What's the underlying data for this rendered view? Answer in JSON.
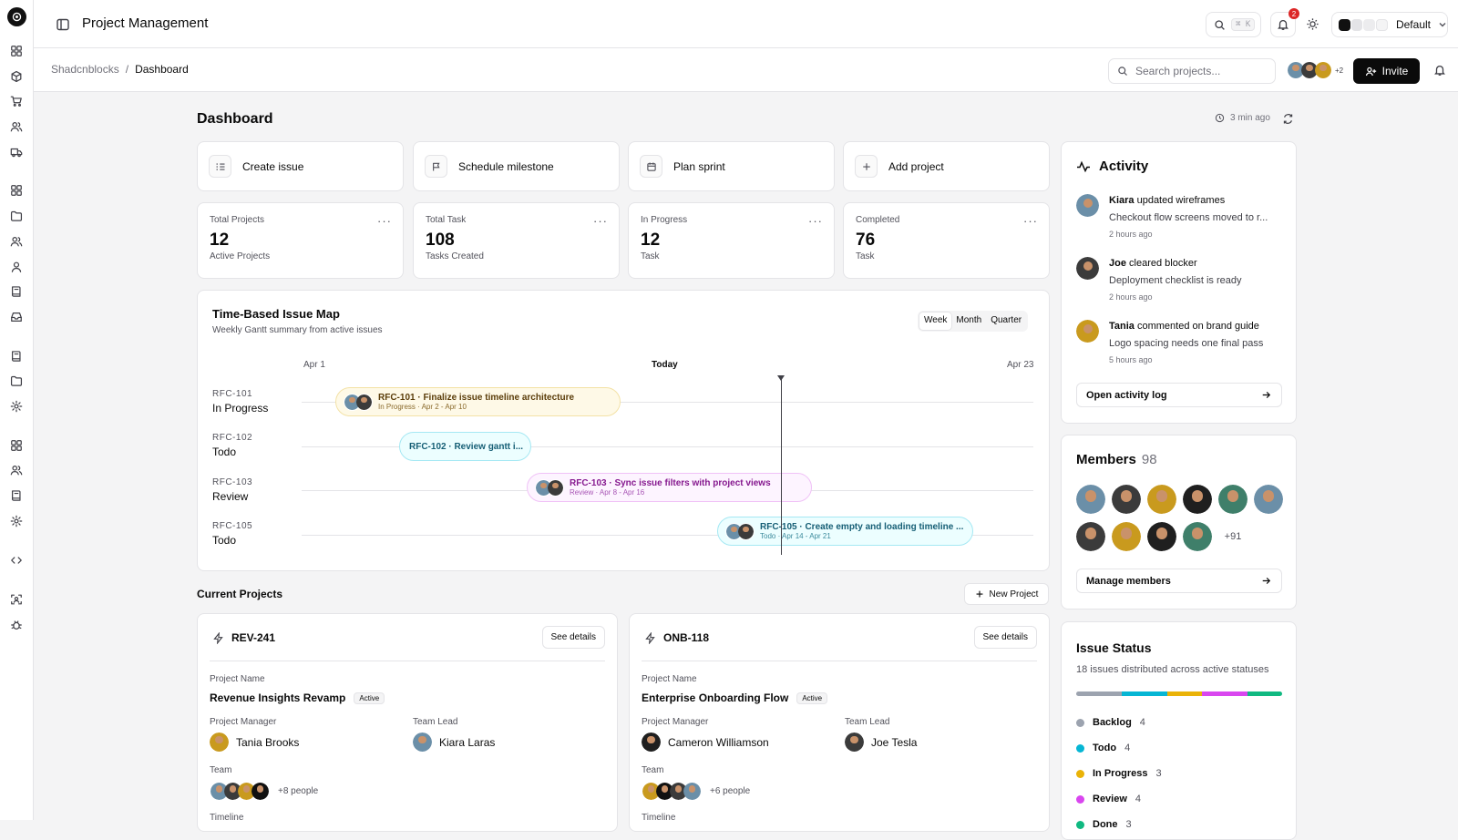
{
  "app": {
    "title": "Project Management",
    "search_shortcut": "⌘ K",
    "notification_count": "2",
    "theme_label": "Default"
  },
  "rail_icons": [
    "grid-icon",
    "box-icon",
    "cart-icon",
    "users-icon",
    "truck-icon",
    "grid-icon",
    "folder-icon",
    "users-icon",
    "user-icon",
    "book-icon",
    "inbox-icon",
    "book-icon",
    "folder-icon",
    "settings-icon",
    "grid-icon",
    "users-icon",
    "book-icon",
    "settings-icon",
    "code-icon",
    "scan-icon",
    "bug-icon"
  ],
  "breadcrumb": {
    "root": "Shadcnblocks",
    "sep": "/",
    "current": "Dashboard"
  },
  "subheader": {
    "search_placeholder": "Search projects...",
    "avatar_more": "+2",
    "invite_label": "Invite"
  },
  "page": {
    "title": "Dashboard",
    "updated": "3 min ago"
  },
  "quick_actions": [
    {
      "label": "Create issue",
      "icon": "list-icon"
    },
    {
      "label": "Schedule milestone",
      "icon": "flag-icon"
    },
    {
      "label": "Plan sprint",
      "icon": "calendar-icon"
    },
    {
      "label": "Add project",
      "icon": "plus-icon"
    }
  ],
  "stats": [
    {
      "label": "Total Projects",
      "value": "12",
      "sub": "Active Projects"
    },
    {
      "label": "Total Task",
      "value": "108",
      "sub": "Tasks Created"
    },
    {
      "label": "In Progress",
      "value": "12",
      "sub": "Task"
    },
    {
      "label": "Completed",
      "value": "76",
      "sub": "Task"
    }
  ],
  "gantt": {
    "title": "Time-Based Issue Map",
    "subtitle": "Weekly Gantt summary from active issues",
    "ranges": [
      "Week",
      "Month",
      "Quarter"
    ],
    "active_range": "Week",
    "axis_start": "Apr 1",
    "axis_today": "Today",
    "axis_end": "Apr 23",
    "rows": [
      {
        "id": "RFC-101",
        "status": "In Progress",
        "bar_title": "RFC-101 · Finalize issue timeline architecture",
        "bar_meta": "In Progress · Apr 2 - Apr 10"
      },
      {
        "id": "RFC-102",
        "status": "Todo",
        "bar_title": "RFC-102 · Review gantt i...",
        "bar_meta": ""
      },
      {
        "id": "RFC-103",
        "status": "Review",
        "bar_title": "RFC-103 · Sync issue filters with project views",
        "bar_meta": "Review · Apr 8 - Apr 16"
      },
      {
        "id": "RFC-105",
        "status": "Todo",
        "bar_title": "RFC-105 · Create empty and loading timeline ...",
        "bar_meta": "Todo · Apr 14 - Apr 21"
      }
    ]
  },
  "projects_section": {
    "title": "Current Projects",
    "new_label": "New Project"
  },
  "projects": [
    {
      "code": "REV-241",
      "details": "See details",
      "name_label": "Project Name",
      "name": "Revenue Insights Revamp",
      "badge": "Active",
      "pm_label": "Project Manager",
      "pm": "Tania Brooks",
      "lead_label": "Team Lead",
      "lead": "Kiara Laras",
      "team_label": "Team",
      "team_more": "+8 people",
      "timeline_label": "Timeline"
    },
    {
      "code": "ONB-118",
      "details": "See details",
      "name_label": "Project Name",
      "name": "Enterprise Onboarding Flow",
      "badge": "Active",
      "pm_label": "Project Manager",
      "pm": "Cameron Williamson",
      "lead_label": "Team Lead",
      "lead": "Joe Tesla",
      "team_label": "Team",
      "team_more": "+6 people",
      "timeline_label": "Timeline"
    }
  ],
  "activity": {
    "title": "Activity",
    "items": [
      {
        "who": "Kiara",
        "action": " updated wireframes",
        "detail": "Checkout flow screens moved to r...",
        "time": "2 hours ago"
      },
      {
        "who": "Joe",
        "action": " cleared blocker",
        "detail": "Deployment checklist is ready",
        "time": "2 hours ago"
      },
      {
        "who": "Tania",
        "action": " commented on brand guide",
        "detail": "Logo spacing needs one final pass",
        "time": "5 hours ago"
      }
    ],
    "open_label": "Open activity log"
  },
  "members": {
    "title": "Members",
    "count": "98",
    "more": "+91",
    "manage_label": "Manage members"
  },
  "issue_status": {
    "title": "Issue Status",
    "subtitle": "18 issues distributed across active statuses",
    "items": [
      {
        "name": "Backlog",
        "count": 4,
        "color": "#9ca3af"
      },
      {
        "name": "Todo",
        "count": 4,
        "color": "#06b6d4"
      },
      {
        "name": "In Progress",
        "count": 3,
        "color": "#eab308"
      },
      {
        "name": "Review",
        "count": 4,
        "color": "#d946ef"
      },
      {
        "name": "Done",
        "count": 3,
        "color": "#10b981"
      }
    ]
  },
  "colors": {
    "accent": "#0a0a0a",
    "bar_in_progress": "#fef9e7",
    "bar_todo": "#ecfeff",
    "bar_review": "#fdf4ff",
    "notification": "#dc2626"
  }
}
